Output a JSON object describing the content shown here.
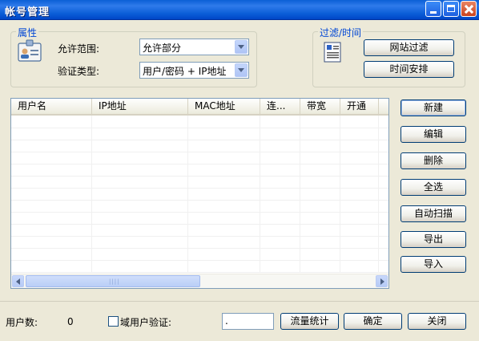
{
  "window": {
    "title": "帐号管理"
  },
  "properties": {
    "legend": "属性",
    "allow_range_label": "允许范围:",
    "allow_range_value": "允许部分",
    "auth_type_label": "验证类型:",
    "auth_type_value": "用户/密码 + IP地址",
    "icon": "id-card-icon"
  },
  "filter": {
    "legend": "过滤/时间",
    "website_filter_label": "网站过滤",
    "schedule_label": "时间安排",
    "icon": "document-icon"
  },
  "table": {
    "columns": [
      "用户名",
      "IP地址",
      "MAC地址",
      "连...",
      "带宽",
      "开通"
    ],
    "rows": []
  },
  "side_buttons": {
    "new": "新建",
    "edit": "编辑",
    "delete": "删除",
    "select_all": "全选",
    "auto_scan": "自动扫描",
    "export": "导出",
    "import": "导入"
  },
  "status": {
    "user_count_label": "用户数:",
    "user_count_value": "0",
    "domain_auth_label": "域用户验证:",
    "domain_auth_checked": false,
    "domain_input_value": ".",
    "traffic_stats_label": "流量统计",
    "ok_label": "确定",
    "close_label": "关闭"
  },
  "colors": {
    "titlebar": "#0A5FD6",
    "legend": "#0046D5",
    "face": "#ECE9D8"
  }
}
